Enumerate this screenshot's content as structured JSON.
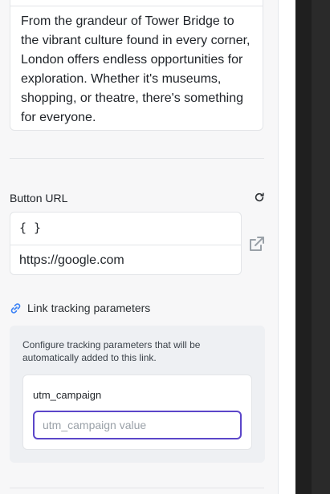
{
  "description": {
    "text": "From the grandeur of Tower Bridge to the vibrant culture found in every corner, London offers endless opportunities for exploration. Whether it's museums, shopping, or theatre, there's something for everyone."
  },
  "button_url": {
    "label": "Button URL",
    "variables_glyph": "{ }",
    "value": "https://google.com"
  },
  "tracking": {
    "label": "Link tracking parameters",
    "help_text": "Configure tracking parameters that will be automatically added to this link.",
    "params": [
      {
        "name": "utm_campaign",
        "value": "",
        "placeholder": "utm_campaign value"
      }
    ]
  },
  "colors": {
    "accent": "#5b46c9",
    "link_icon": "#3b82f6",
    "panel_bg": "#f7f7f8"
  }
}
